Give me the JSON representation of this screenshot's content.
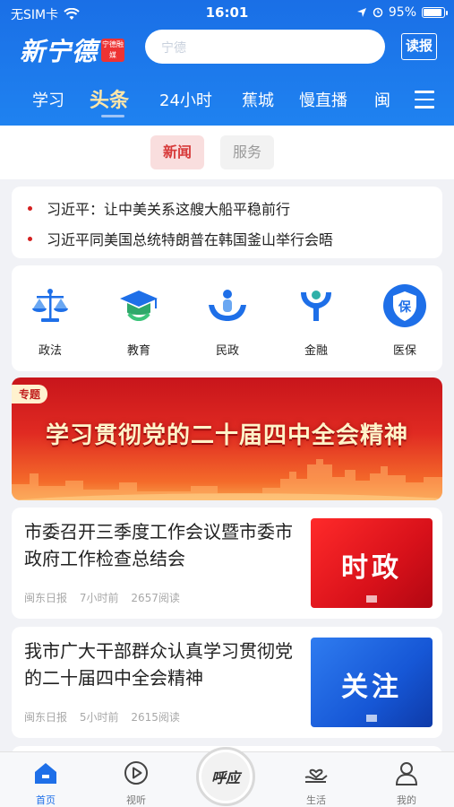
{
  "status_bar": {
    "carrier": "无SIM卡",
    "time": "16:01",
    "battery": "95%",
    "battery_level": 0.95
  },
  "header": {
    "logo_text": "新宁德",
    "logo_seal": "宁德融媒",
    "search_placeholder": "宁德",
    "read_button": "读报"
  },
  "nav": {
    "tabs": [
      "学习",
      "头条",
      "24小时",
      "蕉城",
      "慢直播",
      "闽"
    ],
    "active_index": 1
  },
  "segment": {
    "tabs": [
      "新闻",
      "服务"
    ],
    "active_index": 0
  },
  "headlines": [
    "习近平：让中美关系这艘大船平稳前行",
    "习近平同美国总统特朗普在韩国釜山举行会晤"
  ],
  "services": [
    {
      "label": "政法",
      "icon": "scales-icon"
    },
    {
      "label": "教育",
      "icon": "graduation-cap-icon"
    },
    {
      "label": "民政",
      "icon": "hands-people-icon"
    },
    {
      "label": "金融",
      "icon": "finance-icon"
    },
    {
      "label": "医保",
      "icon": "shield-icon"
    }
  ],
  "banner": {
    "tag": "专题",
    "title": "学习贯彻党的二十届四中全会精神"
  },
  "articles": [
    {
      "title": "市委召开三季度工作会议暨市委市政府工作检查总结会",
      "source": "闽东日报",
      "time": "7小时前",
      "reads": "2657阅读",
      "thumb_text": "时政",
      "thumb_color": "#e01b1f"
    },
    {
      "title": "我市广大干部群众认真学习贯彻党的二十届四中全会精神",
      "source": "闽东日报",
      "time": "5小时前",
      "reads": "2615阅读",
      "thumb_text": "关注",
      "thumb_color": "#1f63e0"
    }
  ],
  "tabbar": {
    "items": [
      "首页",
      "视听",
      "生活",
      "我的"
    ],
    "center_label": "呼应",
    "active_index": 0
  },
  "colors": {
    "brand_blue": "#1f78ee",
    "accent_red": "#d73a3a",
    "tab_active": "#ffe6a8"
  }
}
